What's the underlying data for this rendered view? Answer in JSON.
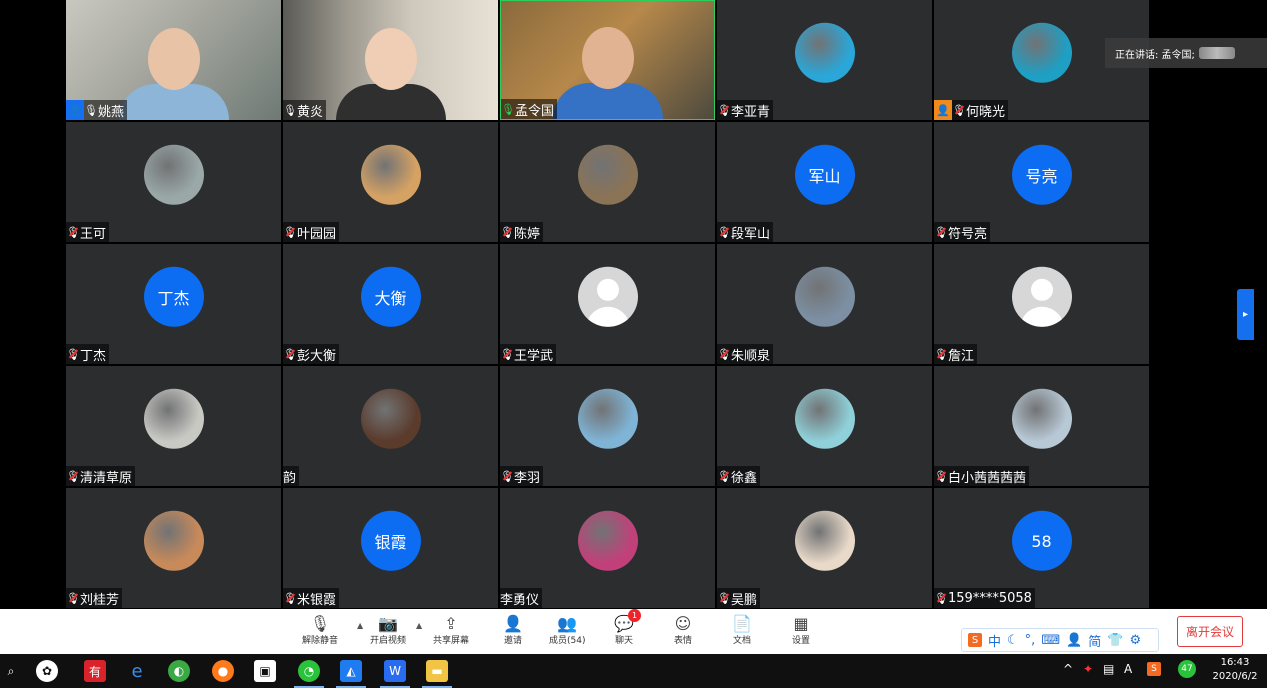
{
  "speaker_banner": {
    "label": "正在讲话: 孟令国;"
  },
  "participants": [
    {
      "name": "姚燕",
      "kind": "video",
      "host": "blue",
      "mic": "on"
    },
    {
      "name": "黄炎",
      "kind": "video",
      "host": "",
      "mic": "on"
    },
    {
      "name": "孟令国",
      "kind": "video",
      "host": "",
      "mic": "on-green"
    },
    {
      "name": "李亚青",
      "kind": "photo",
      "mic": "muted",
      "color": "#2aa6d8"
    },
    {
      "name": "何晓光",
      "kind": "photo",
      "host": "orange",
      "mic": "muted",
      "color": "#1e9fc4"
    },
    {
      "name": "王可",
      "kind": "photo",
      "mic": "muted",
      "color": "#9aa8a8"
    },
    {
      "name": "叶园园",
      "kind": "photo",
      "mic": "muted",
      "color": "#d6a264"
    },
    {
      "name": "陈婷",
      "kind": "photo",
      "mic": "muted",
      "color": "#8b7356"
    },
    {
      "name": "段军山",
      "kind": "initials",
      "initials": "军山",
      "mic": "muted"
    },
    {
      "name": "符号亮",
      "kind": "initials",
      "initials": "号亮",
      "mic": "muted"
    },
    {
      "name": "丁杰",
      "kind": "initials",
      "initials": "丁杰",
      "mic": "muted"
    },
    {
      "name": "彭大衡",
      "kind": "initials",
      "initials": "大衡",
      "mic": "muted"
    },
    {
      "name": "王学武",
      "kind": "default",
      "mic": "muted"
    },
    {
      "name": "朱顺泉",
      "kind": "photo",
      "mic": "muted",
      "color": "#7c8fa3"
    },
    {
      "name": "詹江",
      "kind": "default",
      "mic": "muted"
    },
    {
      "name": "清清草原",
      "kind": "photo",
      "mic": "muted",
      "color": "#c9c9c4"
    },
    {
      "name": "韵",
      "kind": "photo",
      "mic": "none",
      "color": "#5a3b2c"
    },
    {
      "name": "李羽",
      "kind": "photo",
      "mic": "muted",
      "color": "#7fb4d6"
    },
    {
      "name": "徐鑫",
      "kind": "photo",
      "mic": "muted",
      "color": "#8fd0d9"
    },
    {
      "name": "白小茜茜茜茜",
      "kind": "photo",
      "mic": "muted",
      "color": "#b8c9d6"
    },
    {
      "name": "刘桂芳",
      "kind": "photo",
      "mic": "muted",
      "color": "#c98a5a"
    },
    {
      "name": "米银霞",
      "kind": "initials",
      "initials": "银霞",
      "mic": "muted"
    },
    {
      "name": "李勇仪",
      "kind": "photo",
      "mic": "none",
      "color": "#c2407a"
    },
    {
      "name": "吴鹏",
      "kind": "photo",
      "mic": "muted",
      "color": "#e8d9c9"
    },
    {
      "name": "159****5058",
      "kind": "initials",
      "initials": "58",
      "mic": "muted"
    }
  ],
  "toolbar": {
    "unmute": "解除静音",
    "start_video": "开启视频",
    "share_screen": "共享屏幕",
    "invite": "邀请",
    "members": "成员(54)",
    "chat": "聊天",
    "chat_badge": "1",
    "emoji": "表情",
    "docs": "文档",
    "settings": "设置",
    "leave": "离开会议"
  },
  "ime": {
    "mode": "中",
    "simplified": "简"
  },
  "taskbar": {
    "time": "16:43",
    "date": "2020/6/2",
    "apps": [
      "search-icon",
      "pinwheel-icon",
      "youdao-icon",
      "ie-icon",
      "360-icon",
      "firefox-icon",
      "store-icon",
      "wechat-icon",
      "tencent-meeting-icon",
      "wps-icon",
      "explorer-icon"
    ],
    "tray_badge": "47",
    "tray_a": "A"
  }
}
